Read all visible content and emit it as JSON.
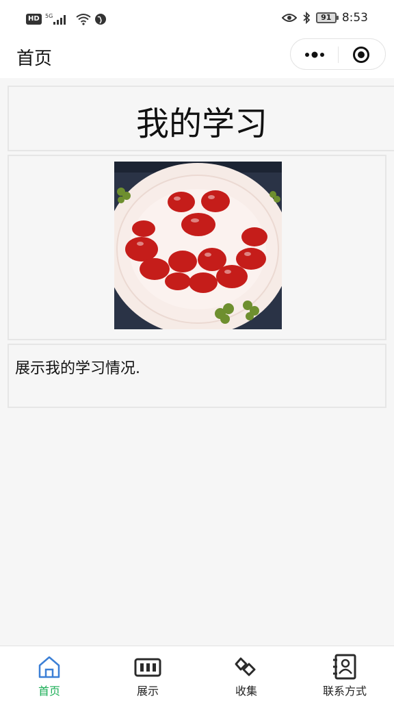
{
  "status_bar": {
    "hd_badge": "HD",
    "network": "5G",
    "battery": "91",
    "time": "8:53"
  },
  "nav": {
    "title": "首页"
  },
  "main": {
    "title": "我的学习",
    "photo_alt": "smiley face made of cherry tomatoes on a plate",
    "description": "展示我的学习情况."
  },
  "tab_bar": {
    "active_color": "#1aad55",
    "items": [
      {
        "label": "首页",
        "icon": "home-icon"
      },
      {
        "label": "展示",
        "icon": "film-strip-icon"
      },
      {
        "label": "收集",
        "icon": "collect-icon"
      },
      {
        "label": "联系方式",
        "icon": "contact-book-icon"
      }
    ]
  }
}
